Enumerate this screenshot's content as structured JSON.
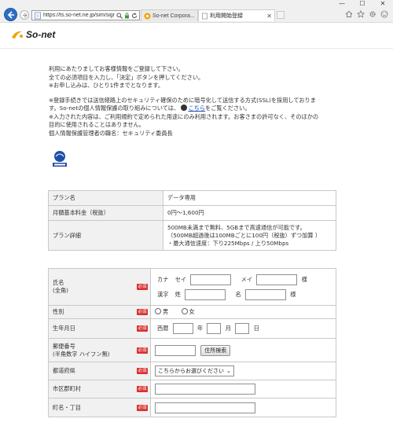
{
  "browser": {
    "address_url": "https://ts.so-net.ne.jp/sim/signup/sim",
    "tabs": [
      {
        "label": "So-net Corpora..."
      },
      {
        "label": "利用開始登録"
      }
    ],
    "window_controls": {
      "minimize": "—",
      "maximize": "☐",
      "close": "✕"
    }
  },
  "header": {
    "logo_text": "So-net"
  },
  "intro": {
    "lines": [
      "利用にあたりましてお客様情報をご登録して下さい。",
      "全ての必須項目を入力し、「決定」ボタンを押してください。",
      "※お申し込みは、ひとり1件までとなります。"
    ],
    "ssl_lines": [
      "※登録手続きでは送信経路上のセキュリティ確保のために暗号化して送信する方式(SSL)を採用しておりま",
      "す。So-netの個人情報保護の取り組みについては、"
    ],
    "kochira_link": "こちら",
    "ssl_line_tail": "をご覧ください。",
    "purpose_lines": [
      "※入力された内容は、ご利用規約で定められた用途にのみ利用されます。お客さまの許可なく、そのほかの",
      "目的に使用されることはありません。",
      "個人情報保護管理者の職名：セキュリティ委員長"
    ]
  },
  "plan": {
    "rows": [
      {
        "label": "プラン名",
        "value": "データ専用"
      },
      {
        "label": "月額基本料金（税抜）",
        "value": "0円～1,600円"
      }
    ],
    "detail_label": "プラン詳細",
    "detail_lines": [
      "500MB未満まで無料、5GBまで高速通信が可能です。",
      "（500MB超過後は100MBごとに100円（税抜）ずつ加算 ）",
      "・最大通信速度：下り225Mbps / 上り50Mbps"
    ]
  },
  "form": {
    "required_badge": "必須",
    "name": {
      "label_1": "氏名",
      "label_2": "(全角)",
      "kana_label": "カナ",
      "sei_kana": "セイ",
      "mei_kana": "メイ",
      "sama": "様",
      "kanji_label": "漢字",
      "sei_kanji": "姓",
      "mei_kanji": "名"
    },
    "gender": {
      "label": "性別",
      "male": "男",
      "female": "女"
    },
    "birthday": {
      "label": "生年月日",
      "era": "西暦",
      "year": "年",
      "month": "月",
      "day": "日"
    },
    "postal": {
      "label_1": "郵便番号",
      "label_2": "(半角数字 ハイフン無)",
      "search_button": "住所検索"
    },
    "prefecture": {
      "label": "都道府県",
      "selected": "こちらからお選びください"
    },
    "city": {
      "label": "市区郡町村"
    },
    "town": {
      "label": "町名・丁目"
    }
  }
}
